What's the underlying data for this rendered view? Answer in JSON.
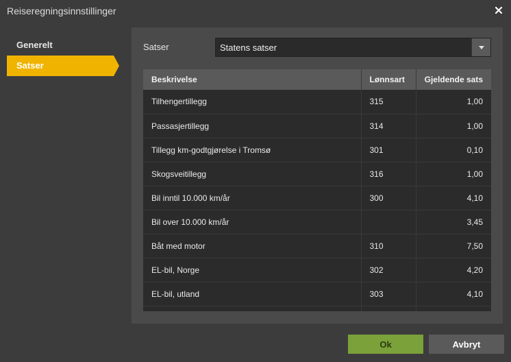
{
  "window": {
    "title": "Reiseregningsinnstillinger"
  },
  "sidebar": {
    "items": [
      {
        "label": "Generelt",
        "active": false
      },
      {
        "label": "Satser",
        "active": true
      }
    ]
  },
  "satser": {
    "label": "Satser",
    "selected": "Statens satser"
  },
  "table": {
    "headers": [
      "Beskrivelse",
      "Lønnsart",
      "Gjeldende sats"
    ],
    "rows": [
      {
        "beskrivelse": "Tilhengertillegg",
        "lonnsart": "315",
        "sats": "1,00"
      },
      {
        "beskrivelse": "Passasjertillegg",
        "lonnsart": "314",
        "sats": "1,00"
      },
      {
        "beskrivelse": "Tillegg km-godtgjørelse i Tromsø",
        "lonnsart": "301",
        "sats": "0,10"
      },
      {
        "beskrivelse": "Skogsveitillegg",
        "lonnsart": "316",
        "sats": "1,00"
      },
      {
        "beskrivelse": "Bil inntil 10.000 km/år",
        "lonnsart": "300",
        "sats": "4,10"
      },
      {
        "beskrivelse": "Bil over 10.000 km/år",
        "lonnsart": "",
        "sats": "3,45"
      },
      {
        "beskrivelse": "Båt med motor",
        "lonnsart": "310",
        "sats": "7,50"
      },
      {
        "beskrivelse": "EL-bil, Norge",
        "lonnsart": "302",
        "sats": "4,20"
      },
      {
        "beskrivelse": "EL-bil, utland",
        "lonnsart": "303",
        "sats": "4,10"
      },
      {
        "beskrivelse": "",
        "lonnsart": "",
        "sats": ""
      }
    ]
  },
  "footer": {
    "ok_label": "Ok",
    "cancel_label": "Avbryt"
  },
  "colors": {
    "accent": "#f0b400",
    "ok": "#7aa13a",
    "panel": "#4a4a4a"
  }
}
